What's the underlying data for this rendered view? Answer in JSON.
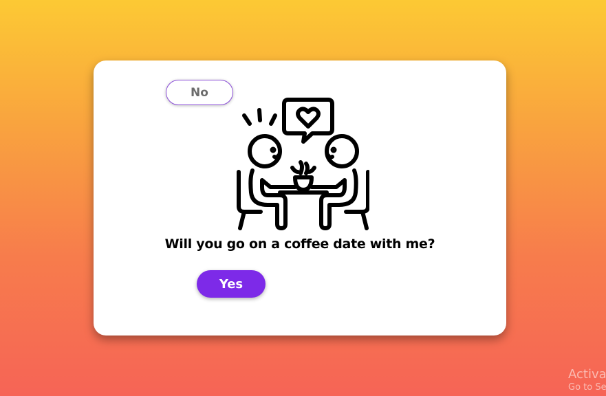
{
  "dialog": {
    "no_label": "No",
    "question": "Will you go on a coffee date with me?",
    "yes_label": "Yes"
  },
  "illustration": {
    "icon": "couple-coffee-date-icon"
  },
  "watermark": {
    "line1": "Activa",
    "line2": "Go to Se"
  },
  "colors": {
    "background_top": "#FCC934",
    "background_bottom": "#F66456",
    "card": "#FFFFFF",
    "yes_button": "#7D2AE8",
    "no_button_border": "#8B4FD8",
    "no_button_text": "#6B6B6B"
  }
}
